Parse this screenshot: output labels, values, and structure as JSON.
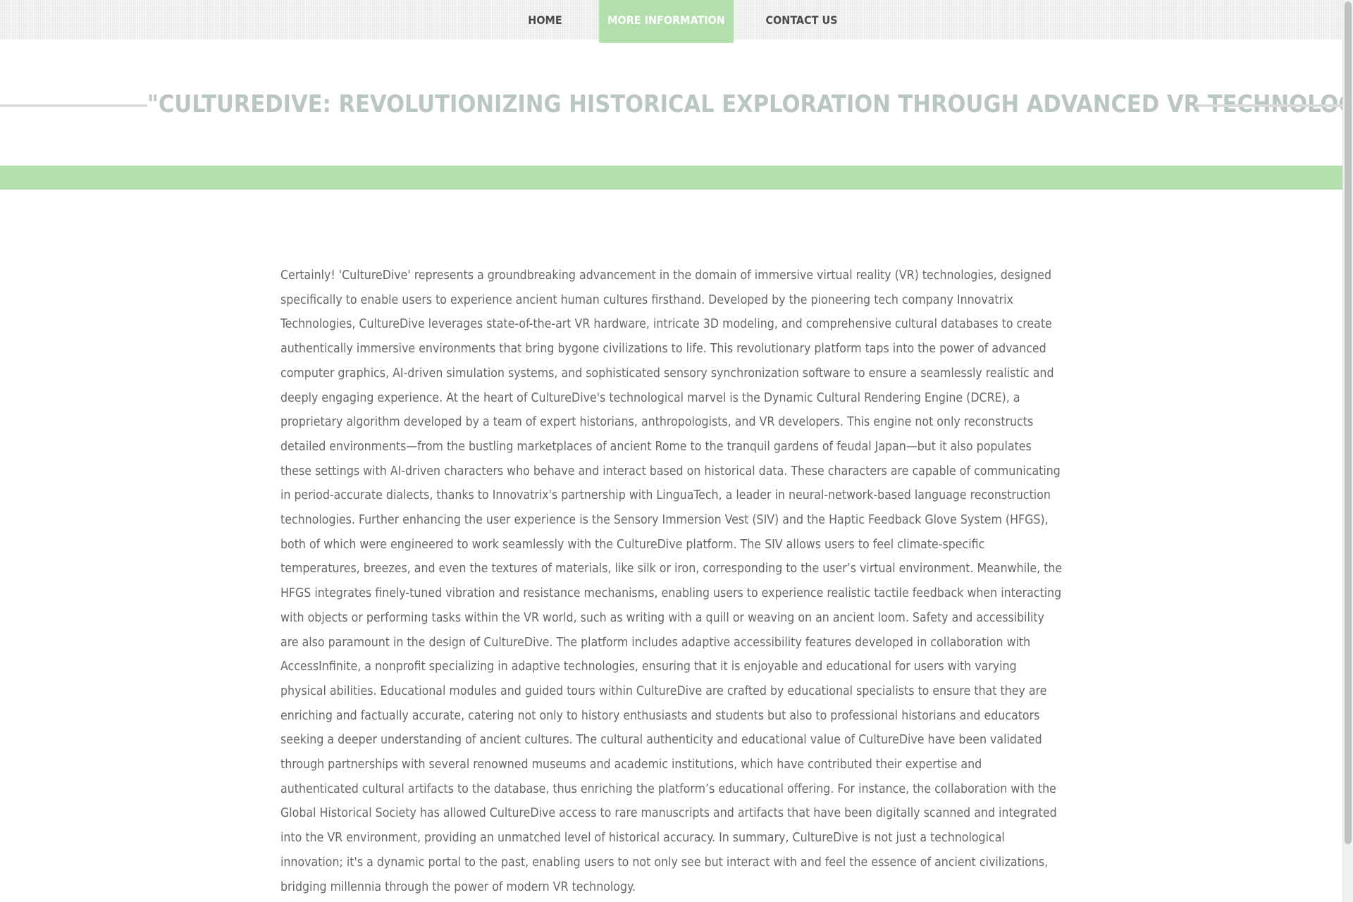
{
  "nav": {
    "items": [
      {
        "label": "HOME",
        "active": false
      },
      {
        "label": "MORE INFORMATION",
        "active": true
      },
      {
        "label": "CONTACT US",
        "active": false
      }
    ]
  },
  "header": {
    "title": "\"CULTUREDIVE: REVOLUTIONIZING HISTORICAL EXPLORATION THROUGH ADVANCED VR TECHNOLOGY\""
  },
  "main": {
    "body_text": "Certainly! 'CultureDive' represents a groundbreaking advancement in the domain of immersive virtual reality (VR) technologies, designed specifically to enable users to experience ancient human cultures firsthand. Developed by the pioneering tech company Innovatrix Technologies, CultureDive leverages state-of-the-art VR hardware, intricate 3D modeling, and comprehensive cultural databases to create authentically immersive environments that bring bygone civilizations to life. This revolutionary platform taps into the power of advanced computer graphics, AI-driven simulation systems, and sophisticated sensory synchronization software to ensure a seamlessly realistic and deeply engaging experience. At the heart of CultureDive's technological marvel is the Dynamic Cultural Rendering Engine (DCRE), a proprietary algorithm developed by a team of expert historians, anthropologists, and VR developers. This engine not only reconstructs detailed environments—from the bustling marketplaces of ancient Rome to the tranquil gardens of feudal Japan—but it also populates these settings with AI-driven characters who behave and interact based on historical data. These characters are capable of communicating in period-accurate dialects, thanks to Innovatrix's partnership with LinguaTech, a leader in neural-network-based language reconstruction technologies. Further enhancing the user experience is the Sensory Immersion Vest (SIV) and the Haptic Feedback Glove System (HFGS), both of which were engineered to work seamlessly with the CultureDive platform. The SIV allows users to feel climate-specific temperatures, breezes, and even the textures of materials, like silk or iron, corresponding to the user’s virtual environment. Meanwhile, the HFGS integrates finely-tuned vibration and resistance mechanisms, enabling users to experience realistic tactile feedback when interacting with objects or performing tasks within the VR world, such as writing with a quill or weaving on an ancient loom. Safety and accessibility are also paramount in the design of CultureDive. The platform includes adaptive accessibility features developed in collaboration with AccessInfinite, a nonprofit specializing in adaptive technologies, ensuring that it is enjoyable and educational for users with varying physical abilities. Educational modules and guided tours within CultureDive are crafted by educational specialists to ensure that they are enriching and factually accurate, catering not only to history enthusiasts and students but also to professional historians and educators seeking a deeper understanding of ancient cultures. The cultural authenticity and educational value of CultureDive have been validated through partnerships with several renowned museums and academic institutions, which have contributed their expertise and authenticated cultural artifacts to the database, thus enriching the platform’s educational offering. For instance, the collaboration with the Global Historical Society has allowed CultureDive access to rare manuscripts and artifacts that have been digitally scanned and integrated into the VR environment, providing an unmatched level of historical accuracy. In summary, CultureDive is not just a technological innovation; it's a dynamic portal to the past, enabling users to not only see but interact with and feel the essence of ancient civilizations, bridging millennia through the power of modern VR technology."
  },
  "colors": {
    "accent_green": "#b2dfad",
    "title_gray": "#b9c6c4",
    "body_text": "#666666",
    "nav_text": "#4a4a4a"
  }
}
